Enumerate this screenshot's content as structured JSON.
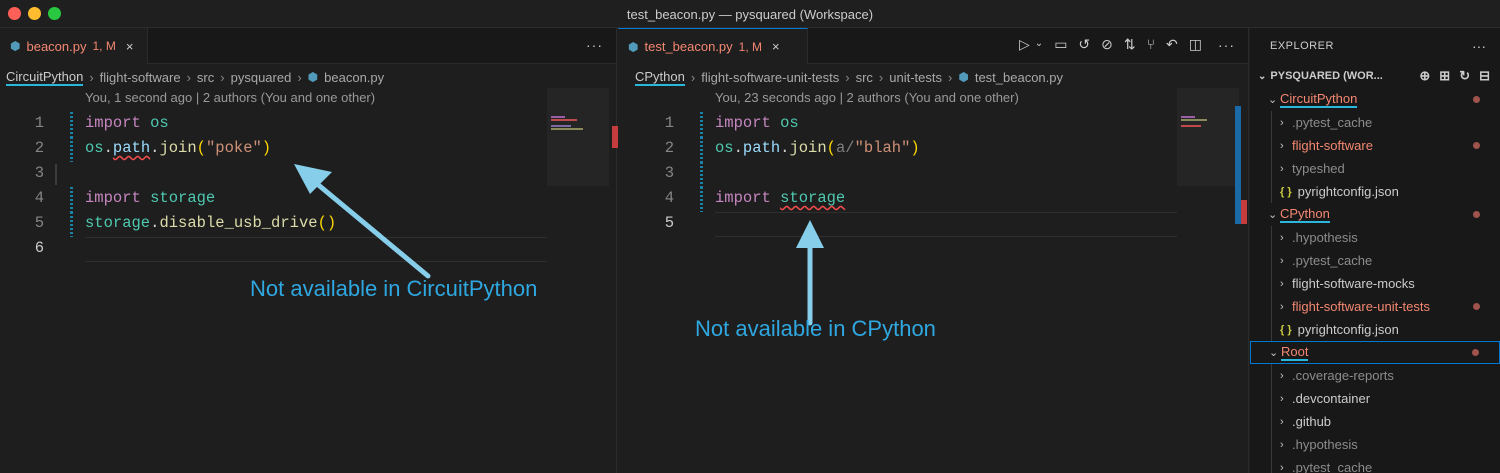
{
  "window": {
    "title": "test_beacon.py — pysquared (Workspace)"
  },
  "left_editor": {
    "tab": {
      "name": "beacon.py",
      "badge": "1, M",
      "close": "×",
      "icon": "python-icon"
    },
    "more": "···",
    "breadcrumb": [
      "CircuitPython",
      "flight-software",
      "src",
      "pysquared",
      "beacon.py"
    ],
    "blame": "You, 1 second ago | 2 authors (You and one other)",
    "line_numbers": [
      "1",
      "2",
      "3",
      "4",
      "5",
      "6"
    ],
    "code": {
      "l1_kw": "import",
      "l1_mod": "os",
      "l2_a": "os",
      "l2_b": "path",
      "l2_fn": "join",
      "l2_str": "\"poke\"",
      "l4_kw": "import",
      "l4_mod": "storage",
      "l5_a": "storage",
      "l5_fn": "disable_usb_drive"
    },
    "annotation": "Not available in CircuitPython"
  },
  "right_editor": {
    "tab": {
      "name": "test_beacon.py",
      "badge": "1, M",
      "close": "×",
      "icon": "python-icon"
    },
    "more": "···",
    "toolbar": [
      "run-icon",
      "dropdown-icon",
      "comment-icon",
      "history-icon",
      "check-icon",
      "git-compare-icon",
      "git-pr-icon",
      "back-icon",
      "split-icon",
      "more-icon"
    ],
    "breadcrumb": [
      "CPython",
      "flight-software-unit-tests",
      "src",
      "unit-tests",
      "test_beacon.py"
    ],
    "blame": "You, 23 seconds ago | 2 authors (You and one other)",
    "line_numbers": [
      "1",
      "2",
      "3",
      "4",
      "5"
    ],
    "code": {
      "l1_kw": "import",
      "l1_mod": "os",
      "l2_a": "os",
      "l2_b": "path",
      "l2_fn": "join",
      "l2_hint": "a/",
      "l2_str": "\"blah\"",
      "l4_kw": "import",
      "l4_mod": "storage"
    },
    "annotation": "Not available in CPython"
  },
  "explorer": {
    "header": "EXPLORER",
    "more": "···",
    "workspace": "PYSQUARED (WOR...",
    "tree": [
      {
        "label": "CircuitPython",
        "kind": "folder-open",
        "level": 1,
        "color": "red",
        "dot": true
      },
      {
        "label": ".pytest_cache",
        "kind": "folder",
        "level": 2,
        "color": "grey",
        "dot": false
      },
      {
        "label": "flight-software",
        "kind": "folder",
        "level": 2,
        "color": "red",
        "dot": true
      },
      {
        "label": "typeshed",
        "kind": "folder",
        "level": 2,
        "color": "grey",
        "dot": false
      },
      {
        "label": "pyrightconfig.json",
        "kind": "json",
        "level": 2,
        "color": "white",
        "dot": false
      },
      {
        "label": "CPython",
        "kind": "folder-open",
        "level": 1,
        "color": "red",
        "dot": true
      },
      {
        "label": ".hypothesis",
        "kind": "folder",
        "level": 2,
        "color": "grey",
        "dot": false
      },
      {
        "label": ".pytest_cache",
        "kind": "folder",
        "level": 2,
        "color": "grey",
        "dot": false
      },
      {
        "label": "flight-software-mocks",
        "kind": "folder",
        "level": 2,
        "color": "white",
        "dot": false
      },
      {
        "label": "flight-software-unit-tests",
        "kind": "folder",
        "level": 2,
        "color": "red",
        "dot": true
      },
      {
        "label": "pyrightconfig.json",
        "kind": "json",
        "level": 2,
        "color": "white",
        "dot": false
      },
      {
        "label": "Root",
        "kind": "folder-open",
        "level": 1,
        "color": "red",
        "dot": true,
        "selected": true
      },
      {
        "label": ".coverage-reports",
        "kind": "folder",
        "level": 2,
        "color": "grey",
        "dot": false
      },
      {
        "label": ".devcontainer",
        "kind": "folder",
        "level": 2,
        "color": "white",
        "dot": false
      },
      {
        "label": ".github",
        "kind": "folder",
        "level": 2,
        "color": "white",
        "dot": false
      },
      {
        "label": ".hypothesis",
        "kind": "folder",
        "level": 2,
        "color": "grey",
        "dot": false
      },
      {
        "label": ".pytest_cache",
        "kind": "folder",
        "level": 2,
        "color": "grey",
        "dot": false
      }
    ]
  },
  "colors": {
    "accent": "#29b8db",
    "annotation": "#2fa7e0",
    "modified": "#f48771",
    "error": "#f14c4c"
  }
}
